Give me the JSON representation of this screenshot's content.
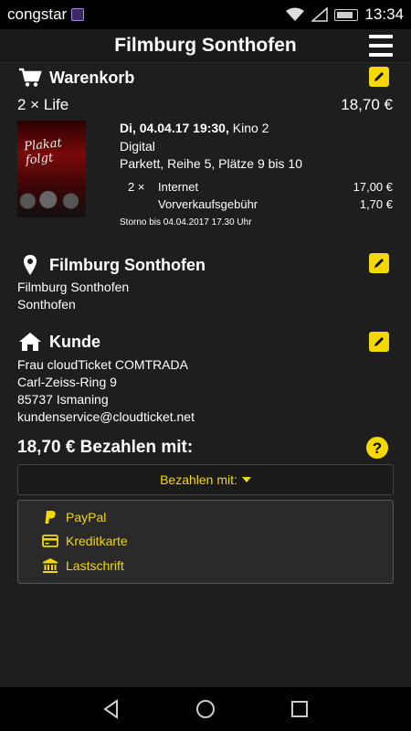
{
  "statusbar": {
    "carrier": "congstar",
    "time": "13:34"
  },
  "header": {
    "title": "Filmburg Sonthofen"
  },
  "cart": {
    "title": "Warenkorb",
    "item_title": "2 × Life",
    "item_total": "18,70 €",
    "poster_text": "Plakat folgt",
    "showtime": "Di, 04.04.17 19:30,",
    "hall": " Kino 2",
    "format": "Digital",
    "seats": "Parkett, Reihe 5, Plätze 9 bis 10",
    "line1_qty": "2 ×",
    "line1_label": "Internet",
    "line1_price": "17,00 €",
    "line2_label": "Vorverkaufsgebühr",
    "line2_price": "1,70 €",
    "storno": "Storno bis 04.04.2017 17.30 Uhr"
  },
  "cinema": {
    "title": "Filmburg Sonthofen",
    "line1": "Filmburg Sonthofen",
    "line2": "Sonthofen"
  },
  "customer": {
    "title": "Kunde",
    "line1": "Frau cloudTicket COMTRADA",
    "line2": "Carl-Zeiss-Ring 9",
    "line3": "85737 Ismaning",
    "line4": "kundenservice@cloudticket.net"
  },
  "payment": {
    "heading": "18,70 € Bezahlen mit:",
    "select_label": "Bezahlen mit:",
    "options": [
      "PayPal",
      "Kreditkarte",
      "Lastschrift"
    ]
  },
  "colors": {
    "accent": "#f5d800",
    "background": "#1e1e1e"
  }
}
